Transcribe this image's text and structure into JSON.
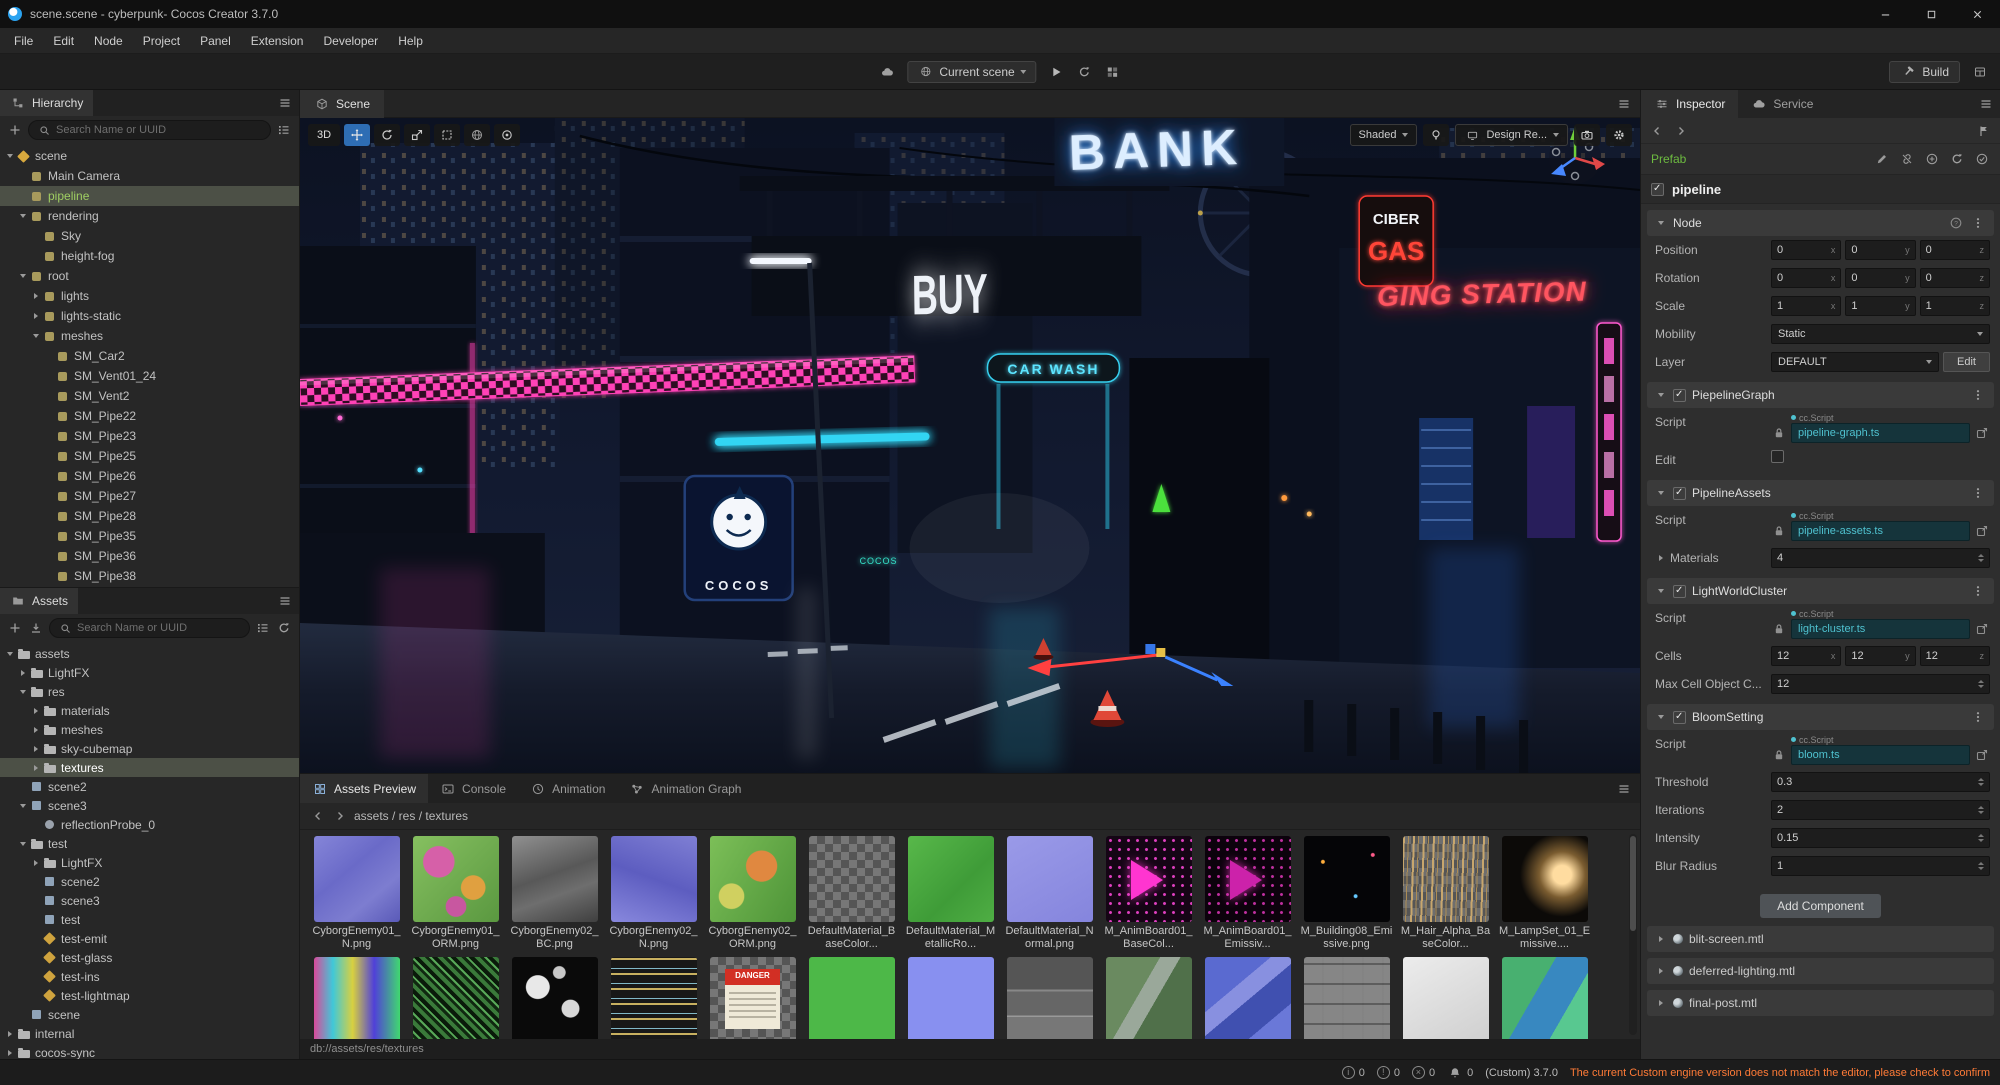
{
  "window": {
    "title": "scene.scene - cyberpunk- Cocos Creator 3.7.0",
    "menus": [
      "File",
      "Edit",
      "Node",
      "Project",
      "Panel",
      "Extension",
      "Developer",
      "Help"
    ]
  },
  "toolbar": {
    "scene_selector": "Current scene",
    "build_label": "Build"
  },
  "hierarchy": {
    "title": "Hierarchy",
    "search_placeholder": "Search Name or UUID",
    "items": [
      {
        "label": "scene",
        "indent": 0,
        "arrow": "down",
        "icon": "scene-root"
      },
      {
        "label": "Main Camera",
        "indent": 1,
        "arrow": "",
        "icon": "node"
      },
      {
        "label": "pipeline",
        "indent": 1,
        "arrow": "",
        "icon": "node",
        "selected": true,
        "green": true
      },
      {
        "label": "rendering",
        "indent": 1,
        "arrow": "down",
        "icon": "node"
      },
      {
        "label": "Sky",
        "indent": 2,
        "arrow": "",
        "icon": "node"
      },
      {
        "label": "height-fog",
        "indent": 2,
        "arrow": "",
        "icon": "node"
      },
      {
        "label": "root",
        "indent": 1,
        "arrow": "down",
        "icon": "node"
      },
      {
        "label": "lights",
        "indent": 2,
        "arrow": "right",
        "icon": "node"
      },
      {
        "label": "lights-static",
        "indent": 2,
        "arrow": "right",
        "icon": "node"
      },
      {
        "label": "meshes",
        "indent": 2,
        "arrow": "down",
        "icon": "node"
      },
      {
        "label": "SM_Car2",
        "indent": 3,
        "arrow": "",
        "icon": "node"
      },
      {
        "label": "SM_Vent01_24",
        "indent": 3,
        "arrow": "",
        "icon": "node"
      },
      {
        "label": "SM_Vent2",
        "indent": 3,
        "arrow": "",
        "icon": "node"
      },
      {
        "label": "SM_Pipe22",
        "indent": 3,
        "arrow": "",
        "icon": "node"
      },
      {
        "label": "SM_Pipe23",
        "indent": 3,
        "arrow": "",
        "icon": "node"
      },
      {
        "label": "SM_Pipe25",
        "indent": 3,
        "arrow": "",
        "icon": "node"
      },
      {
        "label": "SM_Pipe26",
        "indent": 3,
        "arrow": "",
        "icon": "node"
      },
      {
        "label": "SM_Pipe27",
        "indent": 3,
        "arrow": "",
        "icon": "node"
      },
      {
        "label": "SM_Pipe28",
        "indent": 3,
        "arrow": "",
        "icon": "node"
      },
      {
        "label": "SM_Pipe35",
        "indent": 3,
        "arrow": "",
        "icon": "node"
      },
      {
        "label": "SM_Pipe36",
        "indent": 3,
        "arrow": "",
        "icon": "node"
      },
      {
        "label": "SM_Pipe38",
        "indent": 3,
        "arrow": "",
        "icon": "node"
      }
    ]
  },
  "assets_panel": {
    "title": "Assets",
    "search_placeholder": "Search Name or UUID",
    "items": [
      {
        "label": "assets",
        "indent": 0,
        "arrow": "down",
        "icon": "folder"
      },
      {
        "label": "LightFX",
        "indent": 1,
        "arrow": "right",
        "icon": "folder"
      },
      {
        "label": "res",
        "indent": 1,
        "arrow": "down",
        "icon": "folder"
      },
      {
        "label": "materials",
        "indent": 2,
        "arrow": "right",
        "icon": "folder"
      },
      {
        "label": "meshes",
        "indent": 2,
        "arrow": "right",
        "icon": "folder"
      },
      {
        "label": "sky-cubemap",
        "indent": 2,
        "arrow": "right",
        "icon": "folder"
      },
      {
        "label": "textures",
        "indent": 2,
        "arrow": "right",
        "icon": "folder",
        "selected": true
      },
      {
        "label": "scene2",
        "indent": 1,
        "arrow": "",
        "icon": "scene-file"
      },
      {
        "label": "scene3",
        "indent": 1,
        "arrow": "down",
        "icon": "scene-file"
      },
      {
        "label": "reflectionProbe_0",
        "indent": 2,
        "arrow": "",
        "icon": "probe"
      },
      {
        "label": "test",
        "indent": 1,
        "arrow": "down",
        "icon": "folder"
      },
      {
        "label": "LightFX",
        "indent": 2,
        "arrow": "right",
        "icon": "folder"
      },
      {
        "label": "scene2",
        "indent": 2,
        "arrow": "",
        "icon": "scene-file"
      },
      {
        "label": "scene3",
        "indent": 2,
        "arrow": "",
        "icon": "scene-file"
      },
      {
        "label": "test",
        "indent": 2,
        "arrow": "",
        "icon": "scene-file"
      },
      {
        "label": "test-emit",
        "indent": 2,
        "arrow": "",
        "icon": "material"
      },
      {
        "label": "test-glass",
        "indent": 2,
        "arrow": "",
        "icon": "material"
      },
      {
        "label": "test-ins",
        "indent": 2,
        "arrow": "",
        "icon": "material"
      },
      {
        "label": "test-lightmap",
        "indent": 2,
        "arrow": "",
        "icon": "material"
      },
      {
        "label": "scene",
        "indent": 1,
        "arrow": "",
        "icon": "scene-file"
      },
      {
        "label": "internal",
        "indent": 0,
        "arrow": "right",
        "icon": "folder"
      },
      {
        "label": "cocos-sync",
        "indent": 0,
        "arrow": "right",
        "icon": "folder"
      }
    ]
  },
  "scene_view": {
    "tab": "Scene",
    "mode_3d": "3D",
    "shading": "Shaded",
    "design_mode": "Design Re...",
    "signs": {
      "bank": "BANK",
      "buy": "BUY",
      "ciber": "CIBER",
      "gas": "GAS",
      "station": "GING STATION",
      "carwash": "CAR WASH",
      "cocos": "COCOS"
    }
  },
  "preview": {
    "tabs": [
      {
        "label": "Assets Preview",
        "icon": "grid",
        "active": true
      },
      {
        "label": "Console",
        "icon": "terminal",
        "active": false
      },
      {
        "label": "Animation",
        "icon": "clock",
        "active": false
      },
      {
        "label": "Animation Graph",
        "icon": "graph",
        "active": false
      }
    ],
    "breadcrumb": "assets / res / textures",
    "db_path": "db://assets/res/textures",
    "thumbnails": [
      [
        {
          "name": "CyborgEnemy01_N.png",
          "variant": "normal1"
        },
        {
          "name": "CyborgEnemy01_ORM.png",
          "variant": "orm1"
        },
        {
          "name": "CyborgEnemy02_BC.png",
          "variant": "photo"
        },
        {
          "name": "CyborgEnemy02_N.png",
          "variant": "normal2"
        },
        {
          "name": "CyborgEnemy02_ORM.png",
          "variant": "orm2"
        },
        {
          "name": "DefaultMaterial_BaseColor...",
          "variant": "checker"
        },
        {
          "name": "DefaultMaterial_MetallicRo...",
          "variant": "green"
        },
        {
          "name": "DefaultMaterial_Normal.png",
          "variant": "normallight"
        },
        {
          "name": "M_AnimBoard01_BaseCol...",
          "variant": "board",
          "overlay": "play"
        },
        {
          "name": "M_AnimBoard01_Emissiv...",
          "variant": "boardem",
          "overlay": "play"
        },
        {
          "name": "M_Building08_Emissive.png",
          "variant": "buildingem"
        },
        {
          "name": "M_Hair_Alpha_BaseColor...",
          "variant": "hair"
        },
        {
          "name": "M_LampSet_01_Emissive....",
          "variant": "lamp"
        }
      ],
      [
        {
          "name": "",
          "variant": "glitch"
        },
        {
          "name": "",
          "variant": "noisegreen"
        },
        {
          "name": "",
          "variant": "dots"
        },
        {
          "name": "",
          "variant": "windows"
        },
        {
          "name": "",
          "variant": "checker",
          "overlay": "danger",
          "overlay_text": "DANGER"
        },
        {
          "name": "",
          "variant": "flatgreen"
        },
        {
          "name": "",
          "variant": "periwinkle"
        },
        {
          "name": "",
          "variant": "metal"
        },
        {
          "name": "",
          "variant": "metalgreen"
        },
        {
          "name": "",
          "variant": "panelsblue"
        },
        {
          "name": "",
          "variant": "crates"
        },
        {
          "name": "",
          "variant": "white"
        },
        {
          "name": "",
          "variant": "greenblue"
        }
      ]
    ]
  },
  "inspector": {
    "tabs": [
      {
        "label": "Inspector",
        "active": true
      },
      {
        "label": "Service",
        "active": false
      }
    ],
    "prefab_label": "Prefab",
    "node_name": "pipeline",
    "node_section": {
      "title": "Node",
      "rows": [
        {
          "type": "vec3",
          "label": "Position",
          "values": [
            "0",
            "0",
            "0"
          ],
          "axes": [
            "x",
            "y",
            "z"
          ]
        },
        {
          "type": "vec3",
          "label": "Rotation",
          "values": [
            "0",
            "0",
            "0"
          ],
          "axes": [
            "x",
            "y",
            "z"
          ]
        },
        {
          "type": "vec3",
          "label": "Scale",
          "values": [
            "1",
            "1",
            "1"
          ],
          "axes": [
            "x",
            "y",
            "z"
          ]
        },
        {
          "type": "select",
          "label": "Mobility",
          "value": "Static"
        },
        {
          "type": "select-edit",
          "label": "Layer",
          "value": "DEFAULT",
          "button": "Edit"
        }
      ]
    },
    "components": [
      {
        "name": "PiepelineGraph",
        "checked": true,
        "rows": [
          {
            "type": "script",
            "label": "Script",
            "tag": "cc.Script",
            "value": "pipeline-graph.ts"
          },
          {
            "type": "checkbox",
            "label": "Edit",
            "checked": false
          }
        ]
      },
      {
        "name": "PipelineAssets",
        "checked": true,
        "rows": [
          {
            "type": "script",
            "label": "Script",
            "tag": "cc.Script",
            "value": "pipeline-assets.ts"
          },
          {
            "type": "group",
            "label": "Materials",
            "value": "4"
          }
        ]
      },
      {
        "name": "LightWorldCluster",
        "checked": true,
        "rows": [
          {
            "type": "script",
            "label": "Script",
            "tag": "cc.Script",
            "value": "light-cluster.ts"
          },
          {
            "type": "vec3",
            "label": "Cells",
            "values": [
              "12",
              "12",
              "12"
            ],
            "axes": [
              "x",
              "y",
              "z"
            ]
          },
          {
            "type": "number",
            "label": "Max Cell Object C...",
            "value": "12"
          }
        ]
      },
      {
        "name": "BloomSetting",
        "checked": true,
        "rows": [
          {
            "type": "script",
            "label": "Script",
            "tag": "cc.Script",
            "value": "bloom.ts"
          },
          {
            "type": "number",
            "label": "Threshold",
            "value": "0.3"
          },
          {
            "type": "number",
            "label": "Iterations",
            "value": "2"
          },
          {
            "type": "number",
            "label": "Intensity",
            "value": "0.15"
          },
          {
            "type": "number",
            "label": "Blur Radius",
            "value": "1"
          }
        ]
      }
    ],
    "add_component_label": "Add Component",
    "material_files": [
      "blit-screen.mtl",
      "deferred-lighting.mtl",
      "final-post.mtl"
    ]
  },
  "statusbar": {
    "counters": [
      {
        "icon": "info",
        "count": "0"
      },
      {
        "icon": "warn",
        "count": "0"
      },
      {
        "icon": "error",
        "count": "0"
      }
    ],
    "bell_count": "0",
    "version": "(Custom) 3.7.0",
    "warning": "The current Custom engine version does not match the editor, please check to confirm"
  },
  "colors": {
    "prefab_green": "#6dbb40",
    "script_teal": "#4fc1cf",
    "warning_orange": "#ff7b37",
    "selection_blue": "#2e6db4",
    "neon_pink": "#ff43b7",
    "neon_cyan": "#35e0ff"
  }
}
